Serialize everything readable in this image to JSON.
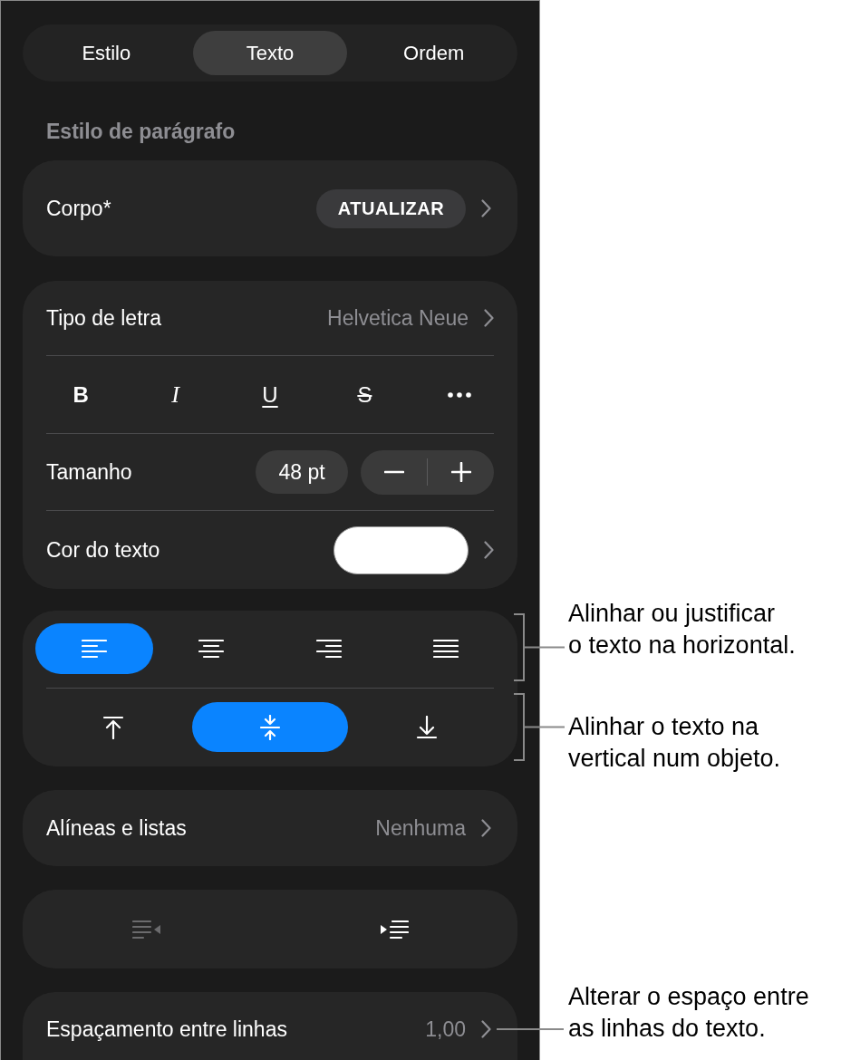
{
  "tabs": [
    {
      "label": "Estilo",
      "selected": false
    },
    {
      "label": "Texto",
      "selected": true
    },
    {
      "label": "Ordem",
      "selected": false
    }
  ],
  "paragraph_style": {
    "header": "Estilo de parágrafo",
    "style_name": "Corpo*",
    "update_button": "ATUALIZAR"
  },
  "font_row": {
    "label": "Tipo de letra",
    "value": "Helvetica Neue"
  },
  "text_style_buttons": [
    {
      "kind": "bold",
      "label": "B"
    },
    {
      "kind": "italic",
      "label": "I"
    },
    {
      "kind": "underline",
      "label": "U"
    },
    {
      "kind": "strikethrough",
      "label": "S"
    },
    {
      "kind": "more"
    }
  ],
  "size_row": {
    "label": "Tamanho",
    "value": "48 pt"
  },
  "text_color_row": {
    "label": "Cor do texto",
    "color": "#ffffff"
  },
  "horizontal_alignment": [
    {
      "kind": "left",
      "selected": true
    },
    {
      "kind": "center",
      "selected": false
    },
    {
      "kind": "right",
      "selected": false
    },
    {
      "kind": "justify",
      "selected": false
    }
  ],
  "vertical_alignment": [
    {
      "kind": "top",
      "selected": false
    },
    {
      "kind": "middle",
      "selected": true
    },
    {
      "kind": "bottom",
      "selected": false
    }
  ],
  "bullets_row": {
    "label": "Alíneas e listas",
    "value": "Nenhuma"
  },
  "indent_buttons": [
    {
      "kind": "decrease",
      "disabled": true
    },
    {
      "kind": "increase",
      "disabled": false
    }
  ],
  "line_spacing_row": {
    "label": "Espaçamento entre linhas",
    "value": "1,00"
  },
  "callouts": [
    {
      "kind": "bracket",
      "lines": [
        "Alinhar ou justificar",
        "o texto na horizontal."
      ]
    },
    {
      "kind": "bracket",
      "lines": [
        "Alinhar o texto na",
        "vertical num objeto."
      ]
    },
    {
      "kind": "leader",
      "lines": [
        "Alterar o espaço entre",
        "as linhas do texto."
      ]
    }
  ]
}
